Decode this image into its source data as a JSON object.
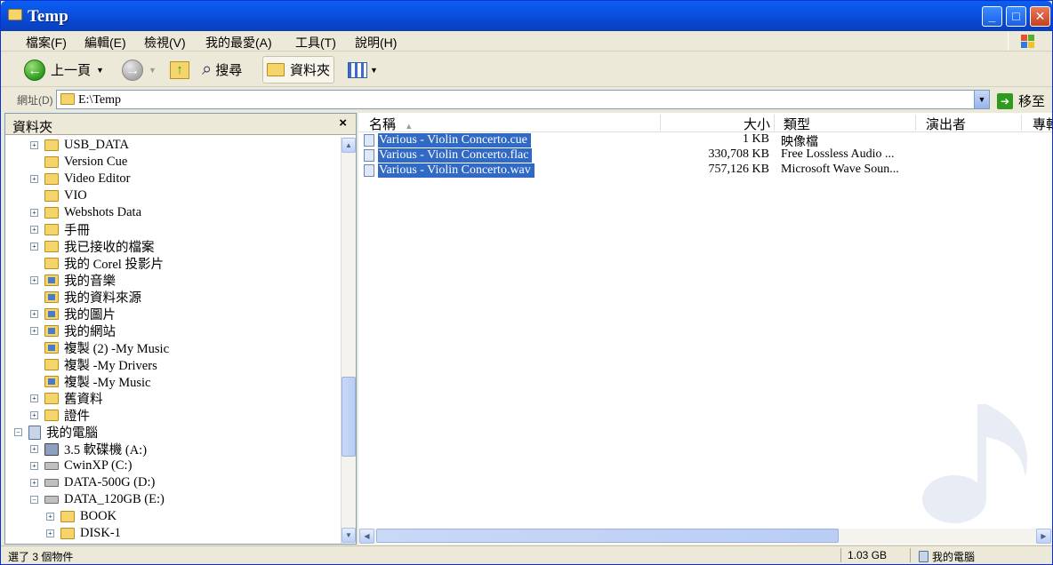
{
  "window": {
    "title": "Temp"
  },
  "menu": [
    "檔案(F)",
    "編輯(E)",
    "檢視(V)",
    "我的最愛(A)",
    "工具(T)",
    "說明(H)"
  ],
  "toolbar": {
    "back": "上一頁",
    "search": "搜尋",
    "folders": "資料夾"
  },
  "address": {
    "label": "網址(D)",
    "path": "E:\\Temp",
    "go": "移至"
  },
  "folder_pane": {
    "title": "資料夾",
    "close": "×",
    "tree": [
      {
        "label": "USB_DATA",
        "expander": "+",
        "icon": "folder"
      },
      {
        "label": "Version Cue",
        "expander": "",
        "icon": "folder"
      },
      {
        "label": "Video Editor",
        "expander": "+",
        "icon": "folder"
      },
      {
        "label": "VIO",
        "expander": "",
        "icon": "folder"
      },
      {
        "label": "Webshots Data",
        "expander": "+",
        "icon": "folder"
      },
      {
        "label": "手冊",
        "expander": "+",
        "icon": "folder"
      },
      {
        "label": "我已接收的檔案",
        "expander": "+",
        "icon": "folder"
      },
      {
        "label": "我的 Corel 投影片",
        "expander": "",
        "icon": "folder"
      },
      {
        "label": "我的音樂",
        "expander": "+",
        "icon": "music-folder"
      },
      {
        "label": "我的資料來源",
        "expander": "",
        "icon": "special"
      },
      {
        "label": "我的圖片",
        "expander": "+",
        "icon": "special"
      },
      {
        "label": "我的網站",
        "expander": "+",
        "icon": "special"
      },
      {
        "label": "複製 (2) -My Music",
        "expander": "",
        "icon": "music-folder"
      },
      {
        "label": "複製 -My Drivers",
        "expander": "",
        "icon": "folder"
      },
      {
        "label": "複製 -My Music",
        "expander": "",
        "icon": "music-folder"
      },
      {
        "label": "舊資料",
        "expander": "+",
        "icon": "folder"
      },
      {
        "label": "證件",
        "expander": "+",
        "icon": "folder"
      },
      {
        "label": "我的電腦",
        "expander": "−",
        "icon": "computer"
      },
      {
        "label": "3.5 軟碟機 (A:)",
        "expander": "+",
        "icon": "floppy"
      },
      {
        "label": "CwinXP (C:)",
        "expander": "+",
        "icon": "drive"
      },
      {
        "label": "DATA-500G (D:)",
        "expander": "+",
        "icon": "drive"
      },
      {
        "label": "DATA_120GB (E:)",
        "expander": "−",
        "icon": "drive"
      },
      {
        "label": "BOOK",
        "expander": "+",
        "icon": "folder"
      },
      {
        "label": "DISK-1",
        "expander": "+",
        "icon": "folder"
      }
    ]
  },
  "file_pane": {
    "columns": [
      "名稱",
      "大小",
      "類型",
      "演出者",
      "專輯"
    ],
    "files": [
      {
        "name": "Various - Violin Concerto.cue",
        "size": "1 KB",
        "type": "映像檔"
      },
      {
        "name": "Various - Violin Concerto.flac",
        "size": "330,708 KB",
        "type": "Free Lossless Audio ..."
      },
      {
        "name": "Various - Violin Concerto.wav",
        "size": "757,126 KB",
        "type": "Microsoft Wave Soun..."
      }
    ]
  },
  "status": {
    "selection": "選了 3 個物件",
    "size": "1.03 GB",
    "location": "我的電腦"
  },
  "colors": {
    "selection": "#316ac5",
    "titlebar": "#0a5ff0",
    "face": "#ece9d8"
  }
}
